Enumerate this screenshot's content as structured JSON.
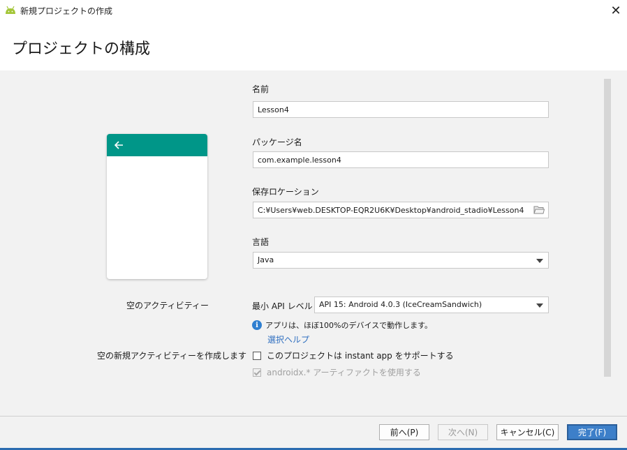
{
  "window": {
    "title": "新規プロジェクトの作成",
    "close_glyph": "✕"
  },
  "header": {
    "title": "プロジェクトの構成"
  },
  "preview": {
    "label": "空のアクティビティー",
    "bar_color": "#009688"
  },
  "form": {
    "name_label": "名前",
    "name_value": "Lesson4",
    "package_label": "パッケージ名",
    "package_value": "com.example.lesson4",
    "location_label": "保存ロケーション",
    "location_value": "C:¥Users¥web.DESKTOP-EQR2U6K¥Desktop¥android_stadio¥Lesson4",
    "language_label": "言語",
    "language_value": "Java",
    "min_api_label": "最小 API レベル",
    "min_api_value": "API 15: Android 4.0.3 (IceCreamSandwich)",
    "info_text": "アプリは、ほぼ100%のデバイスで動作します。",
    "help_link": "選択ヘルプ",
    "left_label_instant": "空の新規アクティビティーを作成します",
    "instant_app_label": "このプロジェクトは instant app をサポートする",
    "androidx_label": "androidx.* アーティファクトを使用する"
  },
  "buttons": {
    "previous": "前へ(P)",
    "next": "次へ(N)",
    "cancel": "キャンセル(C)",
    "finish": "完了(F)"
  },
  "colors": {
    "accent": "#3d7fc9",
    "link": "#2f6fc0",
    "android_green": "#a4c639"
  }
}
